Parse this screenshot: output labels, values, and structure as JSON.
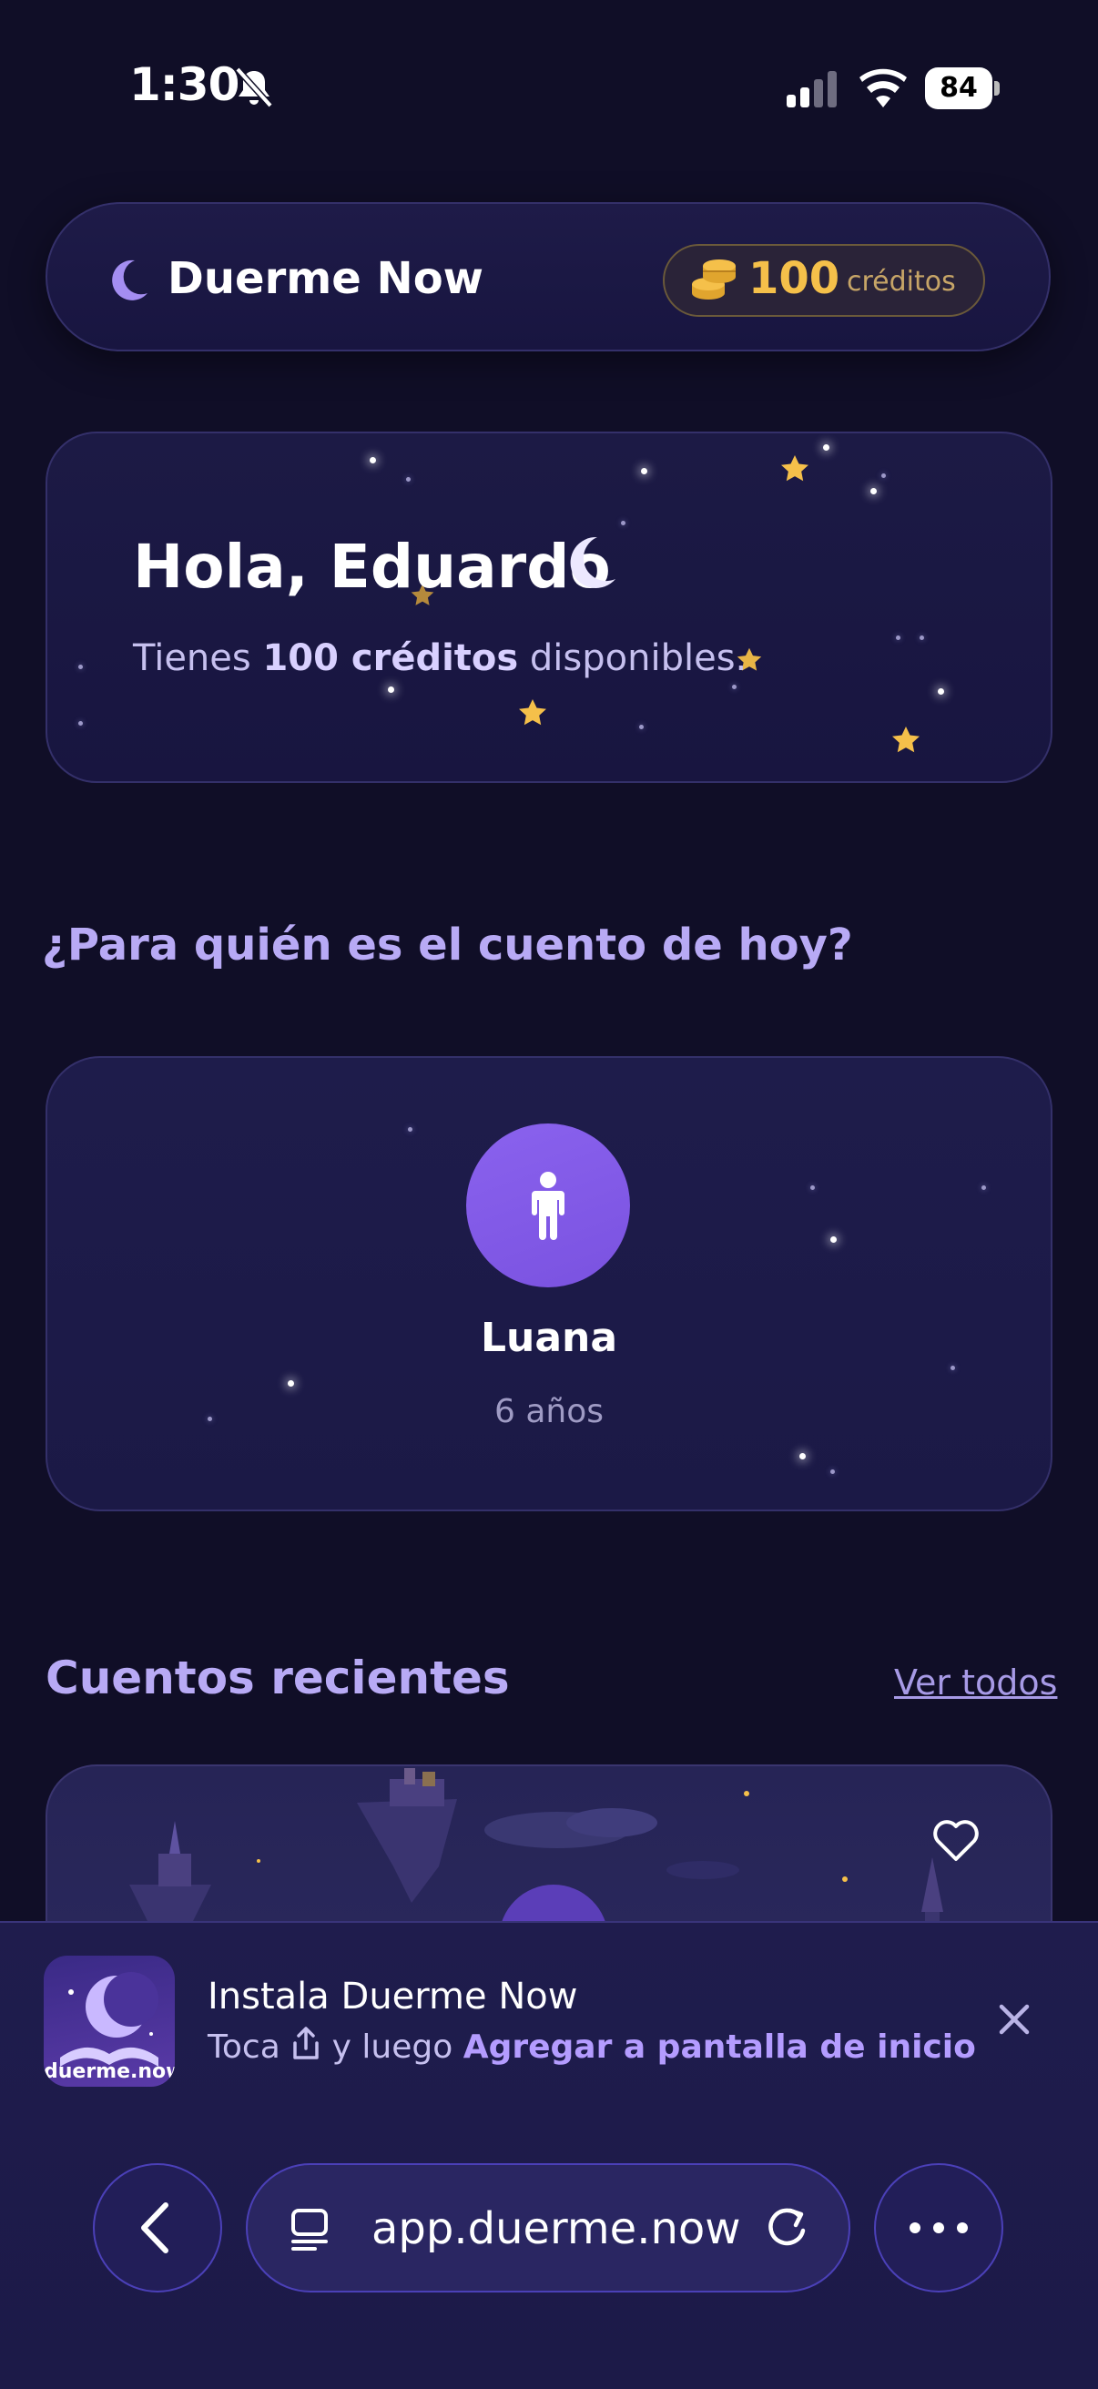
{
  "status_bar": {
    "time": "1:30",
    "battery": "84"
  },
  "header": {
    "app_name": "Duerme Now",
    "credits_value": "100",
    "credits_label": "créditos"
  },
  "greeting": {
    "title": "Hola, Eduardo",
    "sub_prefix": "Tienes ",
    "sub_bold": "100 créditos",
    "sub_suffix": " disponibles."
  },
  "question": "¿Para quién es el cuento de hoy?",
  "child": {
    "name": "Luana",
    "age": "6 años",
    "icon": "child-icon"
  },
  "recent": {
    "title": "Cuentos recientes",
    "see_all": "Ver todos"
  },
  "install_banner": {
    "title": "Instala Duerme Now",
    "sub_prefix": "Toca ",
    "sub_middle": "y luego ",
    "sub_highlight": "Agregar a pantalla de inicio",
    "icon_label": "duerme.now"
  },
  "browser": {
    "url": "app.duerme.now"
  },
  "colors": {
    "background": "#100e27",
    "accent_purple": "#b8aaf5",
    "gold": "#f5c04a",
    "avatar": "#8a62ee"
  }
}
